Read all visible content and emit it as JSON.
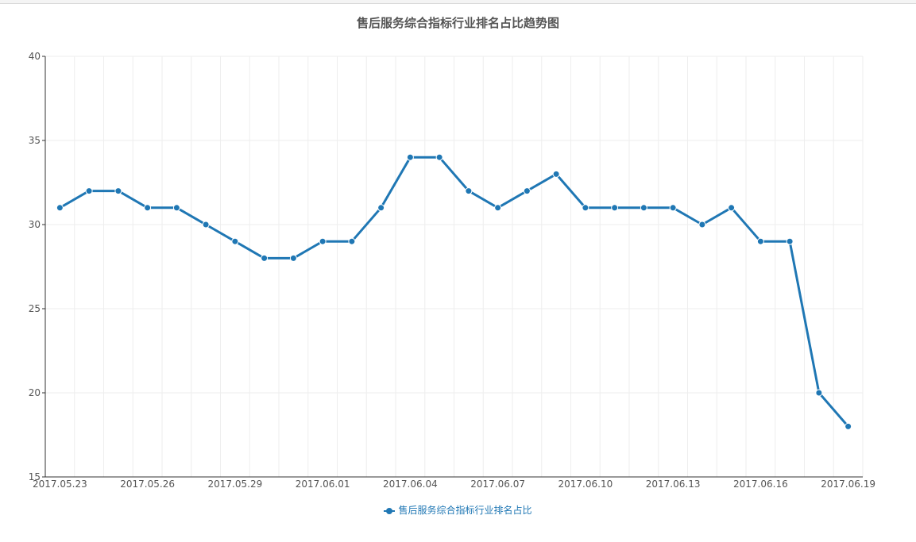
{
  "chart_data": {
    "type": "line",
    "title": "售后服务综合指标行业排名占比趋势图",
    "xlabel": "",
    "ylabel": "",
    "ylim": [
      15,
      40
    ],
    "yticks": [
      "15",
      "20",
      "25",
      "30",
      "35",
      "40"
    ],
    "x": [
      "2017.05.23",
      "2017.05.24",
      "2017.05.25",
      "2017.05.26",
      "2017.05.27",
      "2017.05.28",
      "2017.05.29",
      "2017.05.30",
      "2017.05.31",
      "2017.06.01",
      "2017.06.02",
      "2017.06.03",
      "2017.06.04",
      "2017.06.05",
      "2017.06.06",
      "2017.06.07",
      "2017.06.08",
      "2017.06.09",
      "2017.06.10",
      "2017.06.11",
      "2017.06.12",
      "2017.06.13",
      "2017.06.14",
      "2017.06.15",
      "2017.06.16",
      "2017.06.17",
      "2017.06.18",
      "2017.06.19"
    ],
    "xtick_labels": [
      "2017.05.23",
      "2017.05.26",
      "2017.05.29",
      "2017.06.01",
      "2017.06.04",
      "2017.06.07",
      "2017.06.10",
      "2017.06.13",
      "2017.06.16",
      "2017.06.19"
    ],
    "series": [
      {
        "name": "售后服务综合指标行业排名占比",
        "color": "#1f77b4",
        "values": [
          31,
          32,
          32,
          31,
          31,
          30,
          29,
          28,
          28,
          29,
          29,
          31,
          34,
          34,
          32,
          31,
          32,
          33,
          31,
          31,
          31,
          31,
          30,
          31,
          29,
          29,
          20,
          18
        ]
      }
    ],
    "grid": true,
    "legend_position": "bottom-center"
  }
}
